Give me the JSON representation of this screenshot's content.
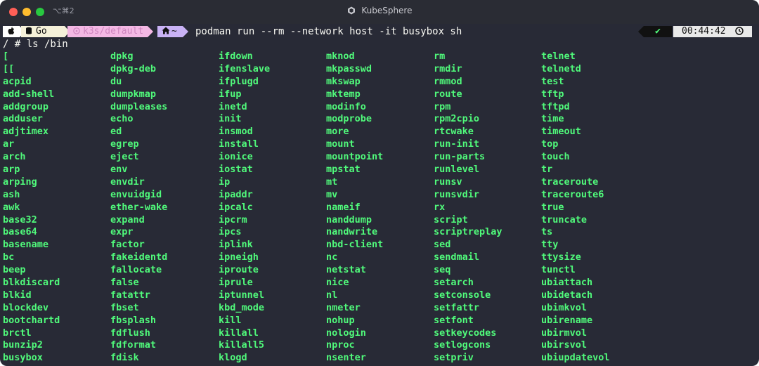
{
  "window": {
    "shortcut": "⌥⌘2",
    "title": "KubeSphere"
  },
  "prompt": {
    "apple": "",
    "go": "Go",
    "k8s": "k3s/default",
    "home": "~",
    "command": "podman run --rm --network host -it busybox sh",
    "status_check": "✔",
    "time": "00:44:42"
  },
  "shell_line": "/ # ls /bin",
  "columns": [
    [
      "[",
      "[[",
      "acpid",
      "add-shell",
      "addgroup",
      "adduser",
      "adjtimex",
      "ar",
      "arch",
      "arp",
      "arping",
      "ash",
      "awk",
      "base32",
      "base64",
      "basename",
      "bc",
      "beep",
      "blkdiscard",
      "blkid",
      "blockdev",
      "bootchartd",
      "brctl",
      "bunzip2",
      "busybox"
    ],
    [
      "dpkg",
      "dpkg-deb",
      "du",
      "dumpkmap",
      "dumpleases",
      "echo",
      "ed",
      "egrep",
      "eject",
      "env",
      "envdir",
      "envuidgid",
      "ether-wake",
      "expand",
      "expr",
      "factor",
      "fakeidentd",
      "fallocate",
      "false",
      "fatattr",
      "fbset",
      "fbsplash",
      "fdflush",
      "fdformat",
      "fdisk"
    ],
    [
      "ifdown",
      "ifenslave",
      "ifplugd",
      "ifup",
      "inetd",
      "init",
      "insmod",
      "install",
      "ionice",
      "iostat",
      "ip",
      "ipaddr",
      "ipcalc",
      "ipcrm",
      "ipcs",
      "iplink",
      "ipneigh",
      "iproute",
      "iprule",
      "iptunnel",
      "kbd_mode",
      "kill",
      "killall",
      "killall5",
      "klogd"
    ],
    [
      "mknod",
      "mkpasswd",
      "mkswap",
      "mktemp",
      "modinfo",
      "modprobe",
      "more",
      "mount",
      "mountpoint",
      "mpstat",
      "mt",
      "mv",
      "nameif",
      "nanddump",
      "nandwrite",
      "nbd-client",
      "nc",
      "netstat",
      "nice",
      "nl",
      "nmeter",
      "nohup",
      "nologin",
      "nproc",
      "nsenter"
    ],
    [
      "rm",
      "rmdir",
      "rmmod",
      "route",
      "rpm",
      "rpm2cpio",
      "rtcwake",
      "run-init",
      "run-parts",
      "runlevel",
      "runsv",
      "runsvdir",
      "rx",
      "script",
      "scriptreplay",
      "sed",
      "sendmail",
      "seq",
      "setarch",
      "setconsole",
      "setfattr",
      "setfont",
      "setkeycodes",
      "setlogcons",
      "setpriv"
    ],
    [
      "telnet",
      "telnetd",
      "test",
      "tftp",
      "tftpd",
      "time",
      "timeout",
      "top",
      "touch",
      "tr",
      "traceroute",
      "traceroute6",
      "true",
      "truncate",
      "ts",
      "tty",
      "ttysize",
      "tunctl",
      "ubiattach",
      "ubidetach",
      "ubimkvol",
      "ubirename",
      "ubirmvol",
      "ubirsvol",
      "ubiupdatevol"
    ]
  ],
  "colors": {
    "background": "#282a36",
    "entry": "#50fa7b",
    "text": "#f8f8f2"
  },
  "icons": [
    "apple-icon",
    "database-icon",
    "kubernetes-icon",
    "home-icon",
    "checkmark-icon",
    "clock-icon",
    "kubesphere-logo-icon"
  ]
}
